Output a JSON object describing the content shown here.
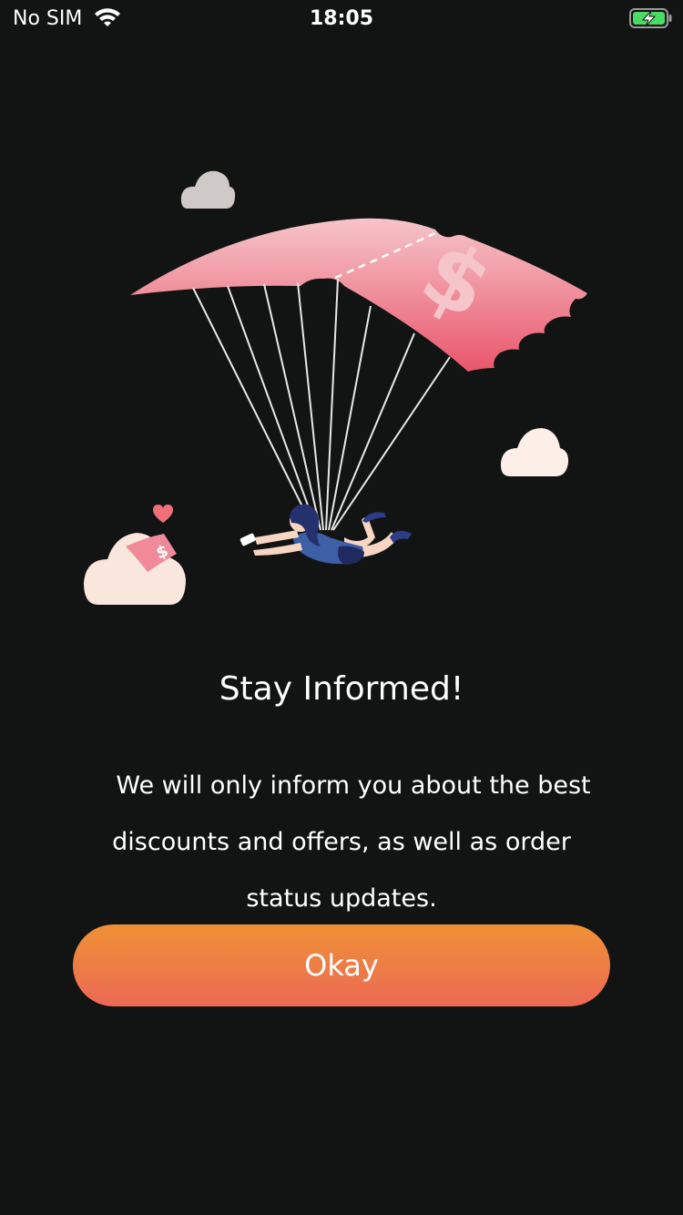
{
  "status_bar": {
    "carrier": "No SIM",
    "time": "18:05",
    "wifi_icon": "wifi-icon",
    "battery_icon": "battery-charging-icon"
  },
  "illustration": {
    "description_icon": "parachute-discount-illustration-icon"
  },
  "dialog": {
    "title": "Stay Informed!",
    "message": "We will only inform you about the best discounts and offers, as well as order status updates.",
    "button_label": "Okay"
  },
  "colors": {
    "background": "#121313",
    "button_top": "#ee9135",
    "button_bottom": "#ec6a55",
    "parachute": "#ec6b7c",
    "battery_green": "#4cd964"
  }
}
